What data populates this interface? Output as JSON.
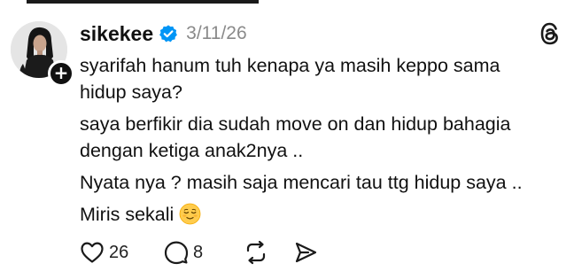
{
  "post": {
    "author": {
      "username": "sikekee",
      "verified": true,
      "avatar_alt": "Profile photo of sikekee"
    },
    "timestamp": "3/11/26",
    "paragraphs": [
      "syarifah hanum tuh kenapa ya masih keppo sama\nhidup saya?",
      "saya berfikir dia sudah move on dan hidup bahagia\ndengan ketiga anak2nya ..",
      "Nyata nya ? masih saja mencari tau ttg hidup saya ..",
      "Miris sekali"
    ],
    "trailing_emoji": "relieved-face-emoji",
    "actions": {
      "like_count": "26",
      "reply_count": "8"
    }
  },
  "icons": {
    "verified": "verified-badge-icon",
    "threads": "threads-logo-icon",
    "follow": "plus-icon",
    "like": "heart-icon",
    "reply": "comment-bubble-icon",
    "repost": "repost-icon",
    "share": "send-icon"
  },
  "colors": {
    "verified_blue": "#0095f6",
    "text": "#111111",
    "muted": "#8a8a8a",
    "icon": "#1a1a1a"
  }
}
